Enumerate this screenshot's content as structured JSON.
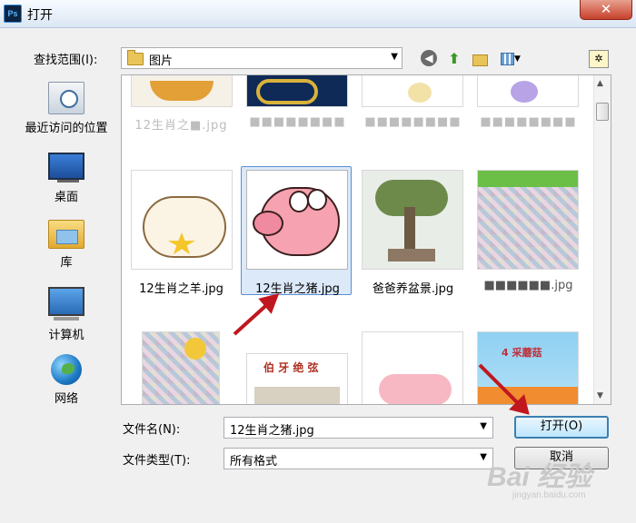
{
  "window": {
    "title": "打开",
    "app_icon": "Ps"
  },
  "look_in": {
    "label": "查找范围(I):",
    "value": "图片"
  },
  "places": [
    {
      "label": "最近访问的位置",
      "icon": "recent-places-icon"
    },
    {
      "label": "桌面",
      "icon": "desktop-icon"
    },
    {
      "label": "库",
      "icon": "library-icon"
    },
    {
      "label": "计算机",
      "icon": "computer-icon"
    },
    {
      "label": "网络",
      "icon": "network-icon"
    }
  ],
  "files": {
    "row0": [
      "12生肖之■.jpg",
      "■■■■■■■■",
      "■■■■■■■■",
      "■■■■■■■■"
    ],
    "row1": [
      "12生肖之羊.jpg",
      "12生肖之猪.jpg",
      "爸爸养盆景.jpg",
      "■■■■■■.jpg"
    ],
    "row2_thumb_text": [
      "伯 牙 绝 弦",
      "4 采蘑菇"
    ]
  },
  "file_name": {
    "label": "文件名(N):",
    "value": "12生肖之猪.jpg"
  },
  "file_type": {
    "label": "文件类型(T):",
    "value": "所有格式"
  },
  "buttons": {
    "open": "打开(O)",
    "cancel": "取消",
    "close": "✕"
  },
  "watermark": {
    "brand": "Bai 经验",
    "url": "jingyan.baidu.com"
  },
  "colors": {
    "annotation_arrow": "#c0171f",
    "selection": "#dbe9f9"
  }
}
